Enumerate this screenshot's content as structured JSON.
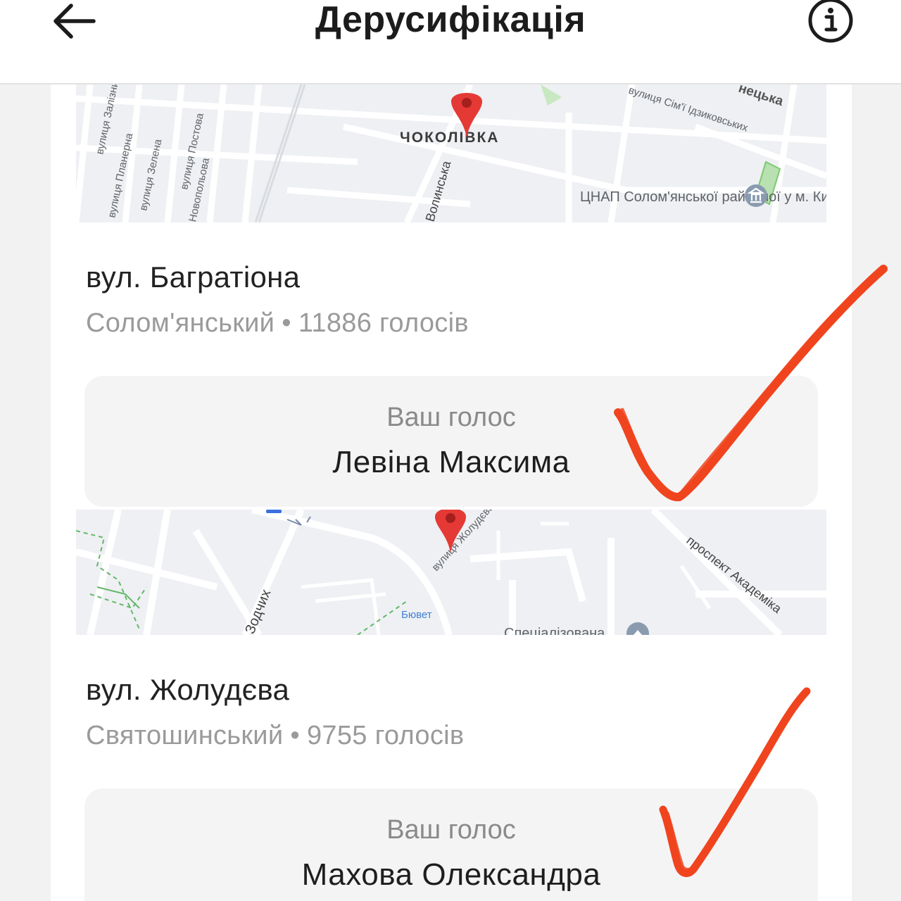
{
  "header": {
    "title": "Дерусифікація",
    "back_icon": "arrow-left-icon",
    "info_icon": "info-icon"
  },
  "cards": [
    {
      "map": {
        "pin_label": "ЧОКОЛІВКА",
        "streets": [
          "вулиця Залізнична",
          "вулиця Планерна",
          "вулиця Зелена",
          "вулиця Постова",
          "Новопольова",
          "Волинська",
          "вулиця Сім'ї Ідзиковських",
          "нецька"
        ],
        "poi": "ЦНАП Солом'янської районної у м. Києві..."
      },
      "street": "вул. Багратіона",
      "district": "Солом'янський",
      "votes": "11886 голосів",
      "vote_label": "Ваш голос",
      "vote_value": "Левіна Максима"
    },
    {
      "map": {
        "streets": [
          "вулиця Жолудєва",
          "Зодчих",
          "проспект Академіка"
        ],
        "water": "Бювет",
        "poi": "Спеціалізована"
      },
      "street": "вул. Жолудєва",
      "district": "Святошинський",
      "votes": "9755 голосів",
      "vote_label": "Ваш голос",
      "vote_value": "Махова Олександра"
    }
  ],
  "colors": {
    "pin": "#e53935",
    "checkmark": "#f0441e",
    "map_bg": "#eef0f3",
    "title": "#1c1c1c",
    "muted": "#9a9a9a"
  }
}
